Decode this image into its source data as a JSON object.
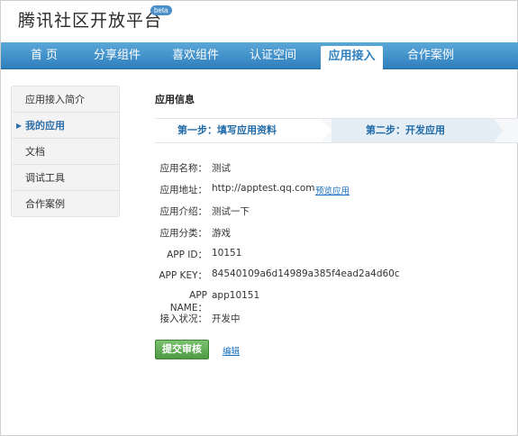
{
  "header": {
    "logo_text": "腾讯社区开放平台",
    "beta_badge": "beta"
  },
  "nav": {
    "items": [
      {
        "label": "首 页"
      },
      {
        "label": "分享组件"
      },
      {
        "label": "喜欢组件"
      },
      {
        "label": "认证空间"
      },
      {
        "label": "应用接入"
      },
      {
        "label": "合作案例"
      }
    ],
    "active_index": 4
  },
  "sidebar": {
    "items": [
      {
        "label": "应用接入简介"
      },
      {
        "label": "我的应用"
      },
      {
        "label": "文档"
      },
      {
        "label": "调试工具"
      },
      {
        "label": "合作案例"
      }
    ],
    "active_index": 1
  },
  "main": {
    "section_title": "应用信息",
    "steps": {
      "step1": "第一步：填写应用资料",
      "step2": "第二步：开发应用"
    },
    "fields": [
      {
        "label": "应用名称：",
        "value": "测试"
      },
      {
        "label": "应用地址：",
        "value": "http://apptest.qq.com"
      },
      {
        "label": "应用介绍：",
        "value": "测试一下"
      },
      {
        "label": "应用分类：",
        "value": "游戏"
      },
      {
        "label": "APP ID：",
        "value": "10151"
      },
      {
        "label": "APP KEY：",
        "value": "84540109a6d14989a385f4ead2a4d60c"
      },
      {
        "label": "APP NAME：",
        "value": "app10151"
      },
      {
        "label": "接入状况：",
        "value": "开发中"
      }
    ],
    "preview_link": "预览应用",
    "submit_button": "提交审核",
    "edit_link": "编辑"
  }
}
